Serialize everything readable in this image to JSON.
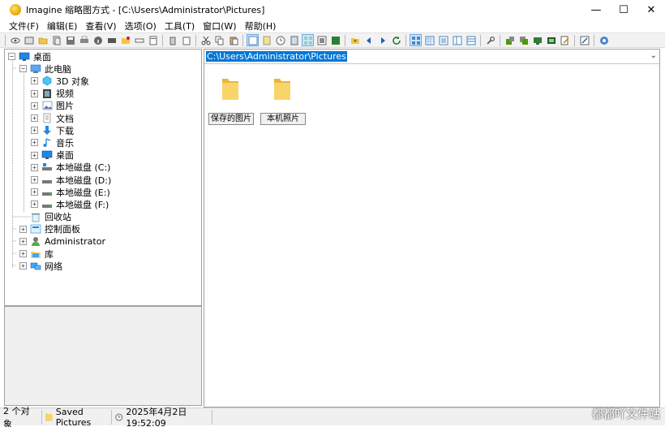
{
  "window": {
    "title": "Imagine 缩略图方式 - [C:\\Users\\Administrator\\Pictures]",
    "minimize": "—",
    "maximize": "☐",
    "close": "✕"
  },
  "menu": [
    "文件(F)",
    "编辑(E)",
    "查看(V)",
    "选项(O)",
    "工具(T)",
    "窗口(W)",
    "帮助(H)"
  ],
  "tree": {
    "items": [
      {
        "label": "桌面",
        "level": 0,
        "expander": "−",
        "icon": "desktop-icon"
      },
      {
        "label": "此电脑",
        "level": 1,
        "expander": "−",
        "icon": "computer-icon"
      },
      {
        "label": "3D 对象",
        "level": 2,
        "expander": "+",
        "icon": "3d-objects-icon"
      },
      {
        "label": "视频",
        "level": 2,
        "expander": "+",
        "icon": "video-icon"
      },
      {
        "label": "图片",
        "level": 2,
        "expander": "+",
        "icon": "pictures-icon"
      },
      {
        "label": "文档",
        "level": 2,
        "expander": "+",
        "icon": "documents-icon"
      },
      {
        "label": "下载",
        "level": 2,
        "expander": "+",
        "icon": "download-icon"
      },
      {
        "label": "音乐",
        "level": 2,
        "expander": "+",
        "icon": "music-icon"
      },
      {
        "label": "桌面",
        "level": 2,
        "expander": "+",
        "icon": "desktop-icon"
      },
      {
        "label": "本地磁盘 (C:)",
        "level": 2,
        "expander": "+",
        "icon": "drive-c-icon"
      },
      {
        "label": "本地磁盘 (D:)",
        "level": 2,
        "expander": "+",
        "icon": "drive-icon"
      },
      {
        "label": "本地磁盘 (E:)",
        "level": 2,
        "expander": "+",
        "icon": "drive-icon"
      },
      {
        "label": "本地磁盘 (F:)",
        "level": 2,
        "expander": "+",
        "icon": "drive-icon"
      },
      {
        "label": "回收站",
        "level": 1,
        "expander": "",
        "icon": "recycle-bin-icon"
      },
      {
        "label": "控制面板",
        "level": 1,
        "expander": "+",
        "icon": "control-panel-icon"
      },
      {
        "label": "Administrator",
        "level": 1,
        "expander": "+",
        "icon": "user-icon"
      },
      {
        "label": "库",
        "level": 1,
        "expander": "+",
        "icon": "library-icon"
      },
      {
        "label": "网络",
        "level": 1,
        "expander": "+",
        "icon": "network-icon"
      }
    ]
  },
  "address": {
    "path": "C:\\Users\\Administrator\\Pictures"
  },
  "thumbnails": [
    {
      "label": "保存的图片",
      "icon": "folder-icon"
    },
    {
      "label": "本机照片",
      "icon": "folder-icon"
    }
  ],
  "status": {
    "count": "2 个对象",
    "folder": "Saved Pictures",
    "datetime": "2025年4月2日 19:52:09"
  },
  "watermark": {
    "text": "都都吖文件站"
  },
  "colors": {
    "selection": "#0078d7",
    "folder": "#f5c542"
  }
}
